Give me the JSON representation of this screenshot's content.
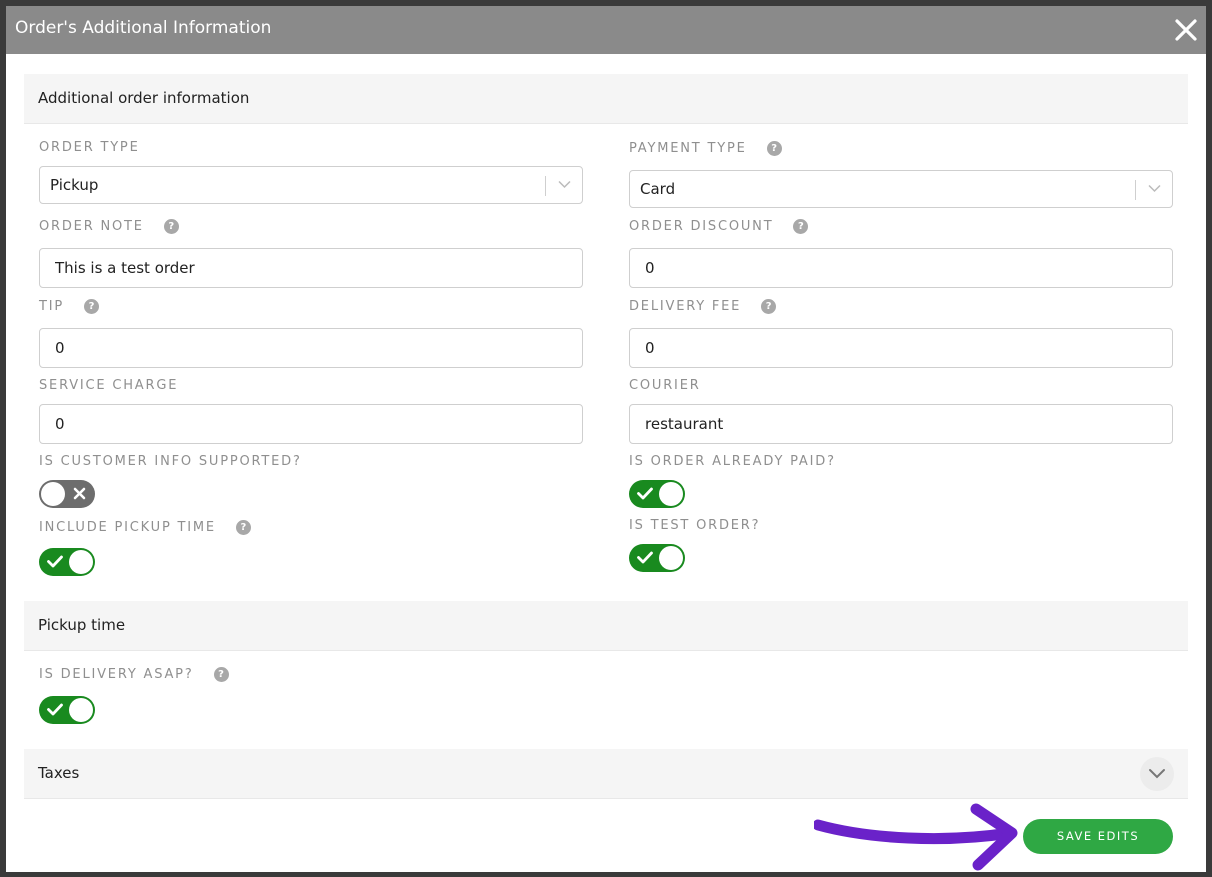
{
  "dialog": {
    "title": "Order's Additional Information",
    "close_icon": "close-icon"
  },
  "sections": {
    "additional": "Additional order information",
    "pickup": "Pickup time",
    "taxes": "Taxes"
  },
  "fields": {
    "order_type": {
      "label": "ORDER TYPE",
      "value": "Pickup"
    },
    "payment_type": {
      "label": "PAYMENT TYPE",
      "value": "Card"
    },
    "order_note": {
      "label": "ORDER NOTE",
      "value": "This is a test order"
    },
    "order_discount": {
      "label": "ORDER DISCOUNT",
      "value": "0"
    },
    "tip": {
      "label": "TIP",
      "value": "0"
    },
    "delivery_fee": {
      "label": "DELIVERY FEE",
      "value": "0"
    },
    "service_charge": {
      "label": "SERVICE CHARGE",
      "value": "0"
    },
    "courier": {
      "label": "COURIER",
      "value": "restaurant"
    }
  },
  "toggles": {
    "customer_info": {
      "label": "IS CUSTOMER INFO SUPPORTED?",
      "on": false
    },
    "already_paid": {
      "label": "IS ORDER ALREADY PAID?",
      "on": true
    },
    "pickup_time": {
      "label": "INCLUDE PICKUP TIME",
      "on": true
    },
    "test_order": {
      "label": "IS TEST ORDER?",
      "on": true
    },
    "delivery_asap": {
      "label": "IS DELIVERY ASAP?",
      "on": true
    }
  },
  "help_glyph": "?",
  "save_label": "SAVE EDITS",
  "colors": {
    "accent_green": "#2fa844",
    "toggle_on": "#198a1f",
    "toggle_off": "#6d6d6d",
    "annotation_arrow": "#6a22c9",
    "titlebar": "#8a8a8a"
  }
}
